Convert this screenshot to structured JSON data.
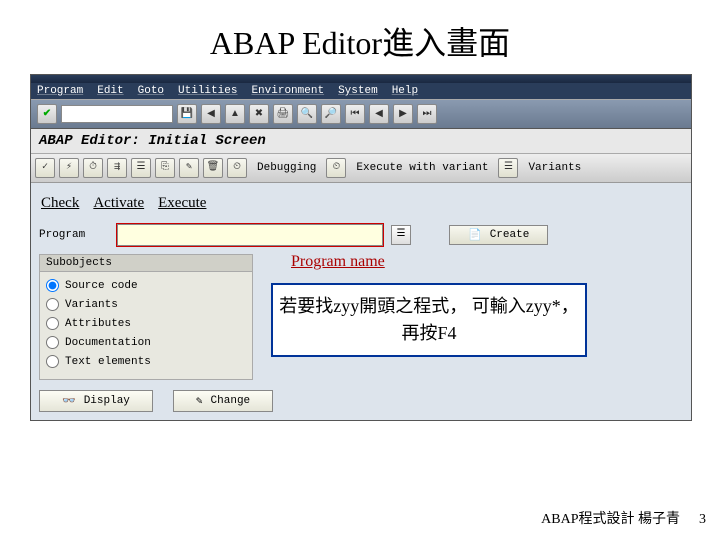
{
  "slide": {
    "title": "ABAP Editor進入畫面",
    "footer": "ABAP程式設計 楊子青",
    "page": "3"
  },
  "menu": {
    "program": "Program",
    "edit": "Edit",
    "goto": "Goto",
    "utilities": "Utilities",
    "environment": "Environment",
    "system": "System",
    "help": "Help"
  },
  "screen": {
    "title": "ABAP Editor: Initial Screen"
  },
  "apptb": {
    "debugging": "Debugging",
    "exec_variant": "Execute with variant",
    "variants": "Variants"
  },
  "annot": {
    "check": "Check",
    "activate": "Activate",
    "execute": "Execute",
    "program_name": "Program name",
    "hint": "若要找zyy開頭之程式，\n可輸入zyy*，再按F4"
  },
  "prog": {
    "label": "Program",
    "value": "",
    "create": "Create"
  },
  "sub": {
    "header": "Subobjects",
    "source": "Source code",
    "variants": "Variants",
    "attributes": "Attributes",
    "documentation": "Documentation",
    "text": "Text elements"
  },
  "btns": {
    "display": "Display",
    "change": "Change"
  }
}
